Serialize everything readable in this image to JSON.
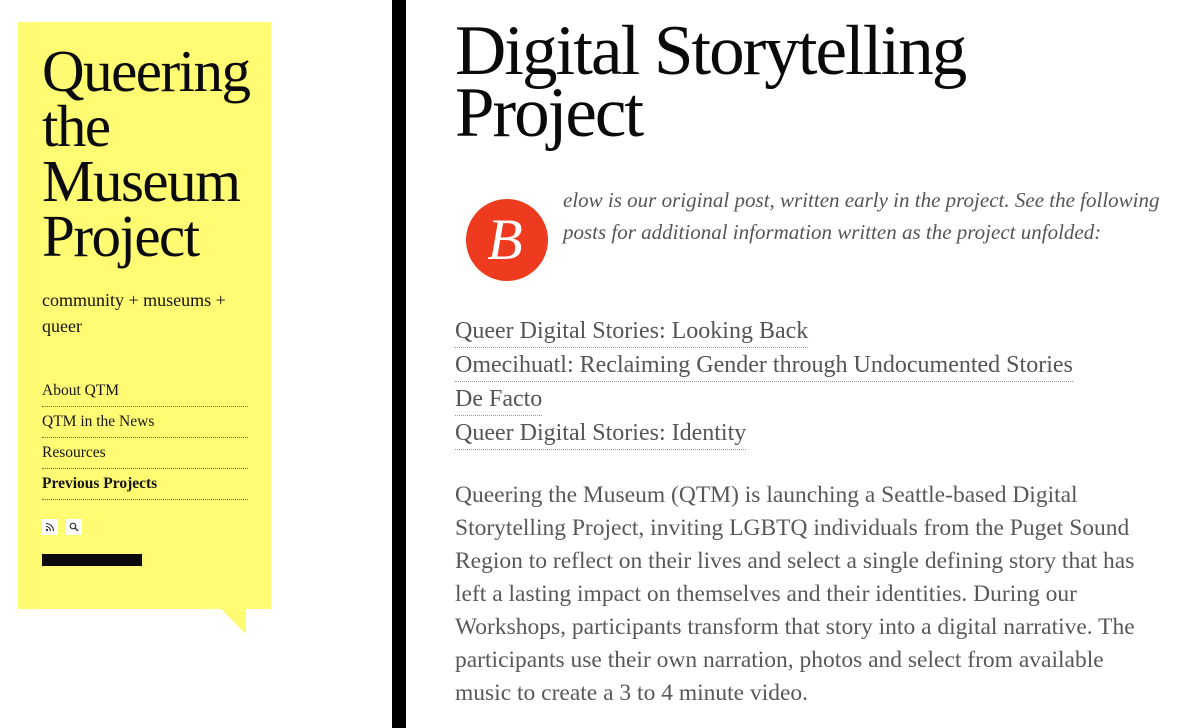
{
  "sidebar": {
    "site_title": "Queering\nthe\nMuseum\nProject",
    "tagline": "community + museums + queer",
    "nav": [
      {
        "label": "About QTM"
      },
      {
        "label": "QTM in the News"
      },
      {
        "label": "Resources"
      },
      {
        "label": "Previous Projects",
        "active": true
      }
    ],
    "social_icons": [
      "rss-icon",
      "search-icon"
    ],
    "bg_color": "#fffb73"
  },
  "main": {
    "title": "Digital Storytelling\nProject",
    "dropcap": "B",
    "dropcap_color": "#ee3a1e",
    "intro": "elow is our original post, written early in the project. See the following posts for additional information written as the project unfolded:",
    "links": [
      "Queer Digital Stories: Looking Back",
      "Omecihuatl: Reclaiming Gender through Undocumented Stories",
      "De Facto",
      "Queer Digital Stories: Identity"
    ],
    "body": "Queering the Museum (QTM) is launching a Seattle-based Digital Storytelling Project, inviting LGBTQ individuals from the Puget Sound Region to reflect on their lives and select a single defining story that has left a lasting impact on themselves and their identities.  During our Workshops, participants transform that story into a digital narrative. The participants use their own narration, photos and select from available music to create a 3 to 4 minute video."
  }
}
